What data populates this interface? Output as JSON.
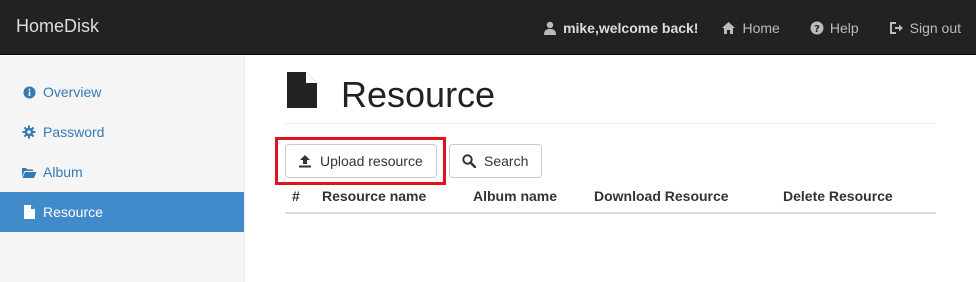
{
  "navbar": {
    "brand": "HomeDisk",
    "welcome": "mike,welcome back!",
    "links": [
      {
        "label": "Home",
        "icon": "home-icon"
      },
      {
        "label": "Help",
        "icon": "question-icon"
      },
      {
        "label": "Sign out",
        "icon": "sign-out-icon"
      }
    ]
  },
  "sidebar": {
    "items": [
      {
        "label": "Overview",
        "icon": "info-icon",
        "active": false
      },
      {
        "label": "Password",
        "icon": "gear-icon",
        "active": false
      },
      {
        "label": "Album",
        "icon": "folder-open-icon",
        "active": false
      },
      {
        "label": "Resource",
        "icon": "file-icon",
        "active": true
      }
    ]
  },
  "main": {
    "title": "Resource",
    "buttons": {
      "upload": "Upload resource",
      "search": "Search"
    },
    "table": {
      "columns": [
        "#",
        "Resource name",
        "Album name",
        "Download Resource",
        "Delete Resource"
      ],
      "rows": []
    }
  },
  "colors": {
    "navbar_bg": "#222222",
    "sidebar_active": "#428bca",
    "link": "#337ab7",
    "highlight_border": "#e0141e"
  }
}
